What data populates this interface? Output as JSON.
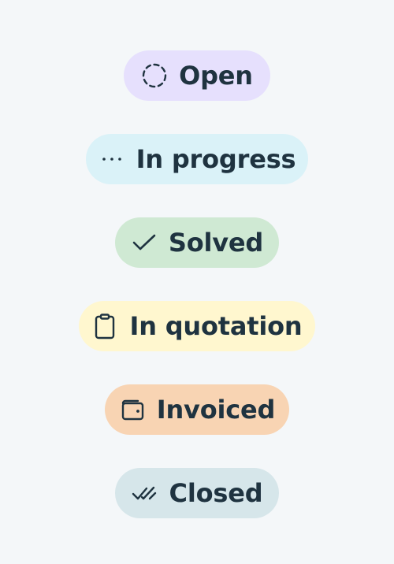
{
  "statuses": [
    {
      "label": "Open",
      "icon": "dashed-circle-icon",
      "bg": "#e6e0fd"
    },
    {
      "label": "In progress",
      "icon": "dots-icon",
      "bg": "#daf2f8"
    },
    {
      "label": "Solved",
      "icon": "check-icon",
      "bg": "#cfe9d3"
    },
    {
      "label": "In quotation",
      "icon": "clipboard-icon",
      "bg": "#fff7cf"
    },
    {
      "label": "Invoiced",
      "icon": "wallet-icon",
      "bg": "#f8d4b3"
    },
    {
      "label": "Closed",
      "icon": "double-check-icon",
      "bg": "#d6e6ea"
    }
  ],
  "colors": {
    "page_bg": "#f4f7f9",
    "text": "#1f3340"
  }
}
